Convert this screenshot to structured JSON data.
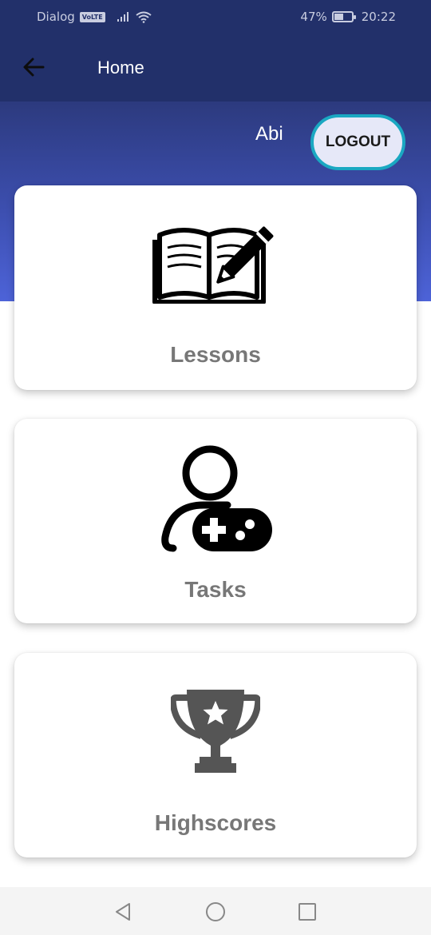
{
  "status_bar": {
    "carrier": "Dialog",
    "volte": "VoLTE",
    "battery_percent": "47%",
    "battery_level": 0.47,
    "time": "20:22"
  },
  "app_bar": {
    "title": "Home",
    "back_icon": "arrow-left-icon"
  },
  "user": {
    "name": "Abi",
    "logout_label": "LOGOUT"
  },
  "cards": [
    {
      "label": "Lessons",
      "icon": "open-book-pencil-icon"
    },
    {
      "label": "Tasks",
      "icon": "user-gamepad-icon"
    },
    {
      "label": "Highscores",
      "icon": "trophy-icon"
    }
  ],
  "nav_bar": {
    "icons": [
      "back-triangle-icon",
      "home-circle-icon",
      "recents-square-icon"
    ]
  },
  "colors": {
    "app_bar": "#22306a",
    "gradient_end": "#4d63d8",
    "logout_border": "#1aa8c2",
    "card_label": "#777777"
  }
}
